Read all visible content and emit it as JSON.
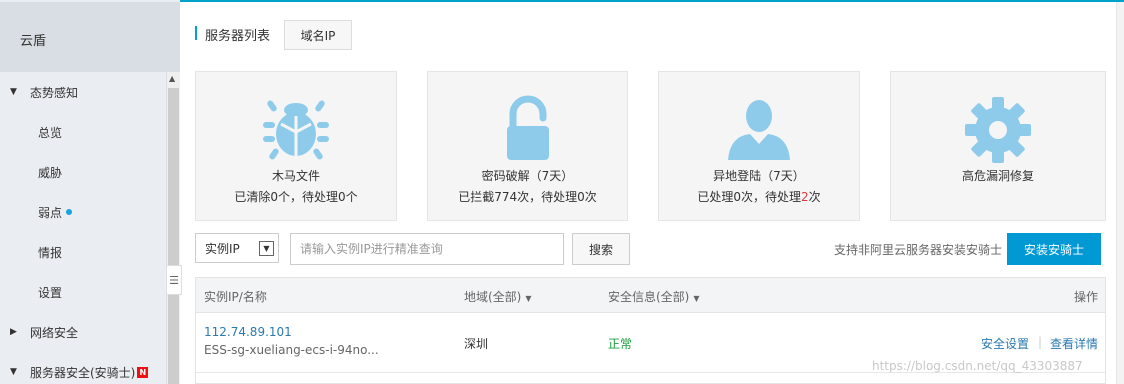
{
  "sidebar": {
    "title": "云盾",
    "items": [
      {
        "label": "态势感知",
        "type": "group",
        "caret": "▼"
      },
      {
        "label": "总览",
        "type": "sub"
      },
      {
        "label": "威胁",
        "type": "sub"
      },
      {
        "label": "弱点",
        "type": "sub",
        "dot": true
      },
      {
        "label": "情报",
        "type": "sub"
      },
      {
        "label": "设置",
        "type": "sub"
      },
      {
        "label": "网络安全",
        "type": "group",
        "caret": "▶"
      },
      {
        "label": "服务器安全(安骑士)",
        "type": "group",
        "caret": "▼",
        "badge": "N"
      }
    ]
  },
  "header": {
    "title": "服务器列表",
    "tab_label": "域名IP"
  },
  "cards": [
    {
      "title": "木马文件",
      "stat_prefix": "已清除0个，待处理0个",
      "icon": "bug-icon"
    },
    {
      "title": "密码破解（7天）",
      "stat_prefix": "已拦截774次，待处理0次",
      "icon": "lock-icon"
    },
    {
      "title": "异地登陆（7天）",
      "stat_before": "已处理0次，待处理",
      "stat_red": "2",
      "stat_after": "次",
      "icon": "user-icon"
    },
    {
      "title": "高危漏洞修复",
      "icon": "gear-icon"
    }
  ],
  "search": {
    "select_value": "实例IP",
    "placeholder": "请输入实例IP进行精准查询",
    "button_label": "搜索",
    "hint": "支持非阿里云服务器安装安骑士",
    "install_label": "安装安骑士"
  },
  "table": {
    "columns": [
      "实例IP/名称",
      "地域(全部)",
      "安全信息(全部)",
      "操作"
    ],
    "rows": [
      {
        "ip": "112.74.89.101",
        "name": "ESS-sg-xueliang-ecs-i-94no...",
        "region": "深圳",
        "status": "正常",
        "actions": [
          "安全设置",
          "查看详情"
        ]
      }
    ]
  },
  "watermark": "https://blog.csdn.net/qq_43303887",
  "colors": {
    "accent": "#00a2ca",
    "primary_button": "#0099d4",
    "icon_blue": "#8ecbea",
    "link": "#2a7ab0",
    "status_ok": "#1a9d3d",
    "alert_red": "#e4393c"
  }
}
